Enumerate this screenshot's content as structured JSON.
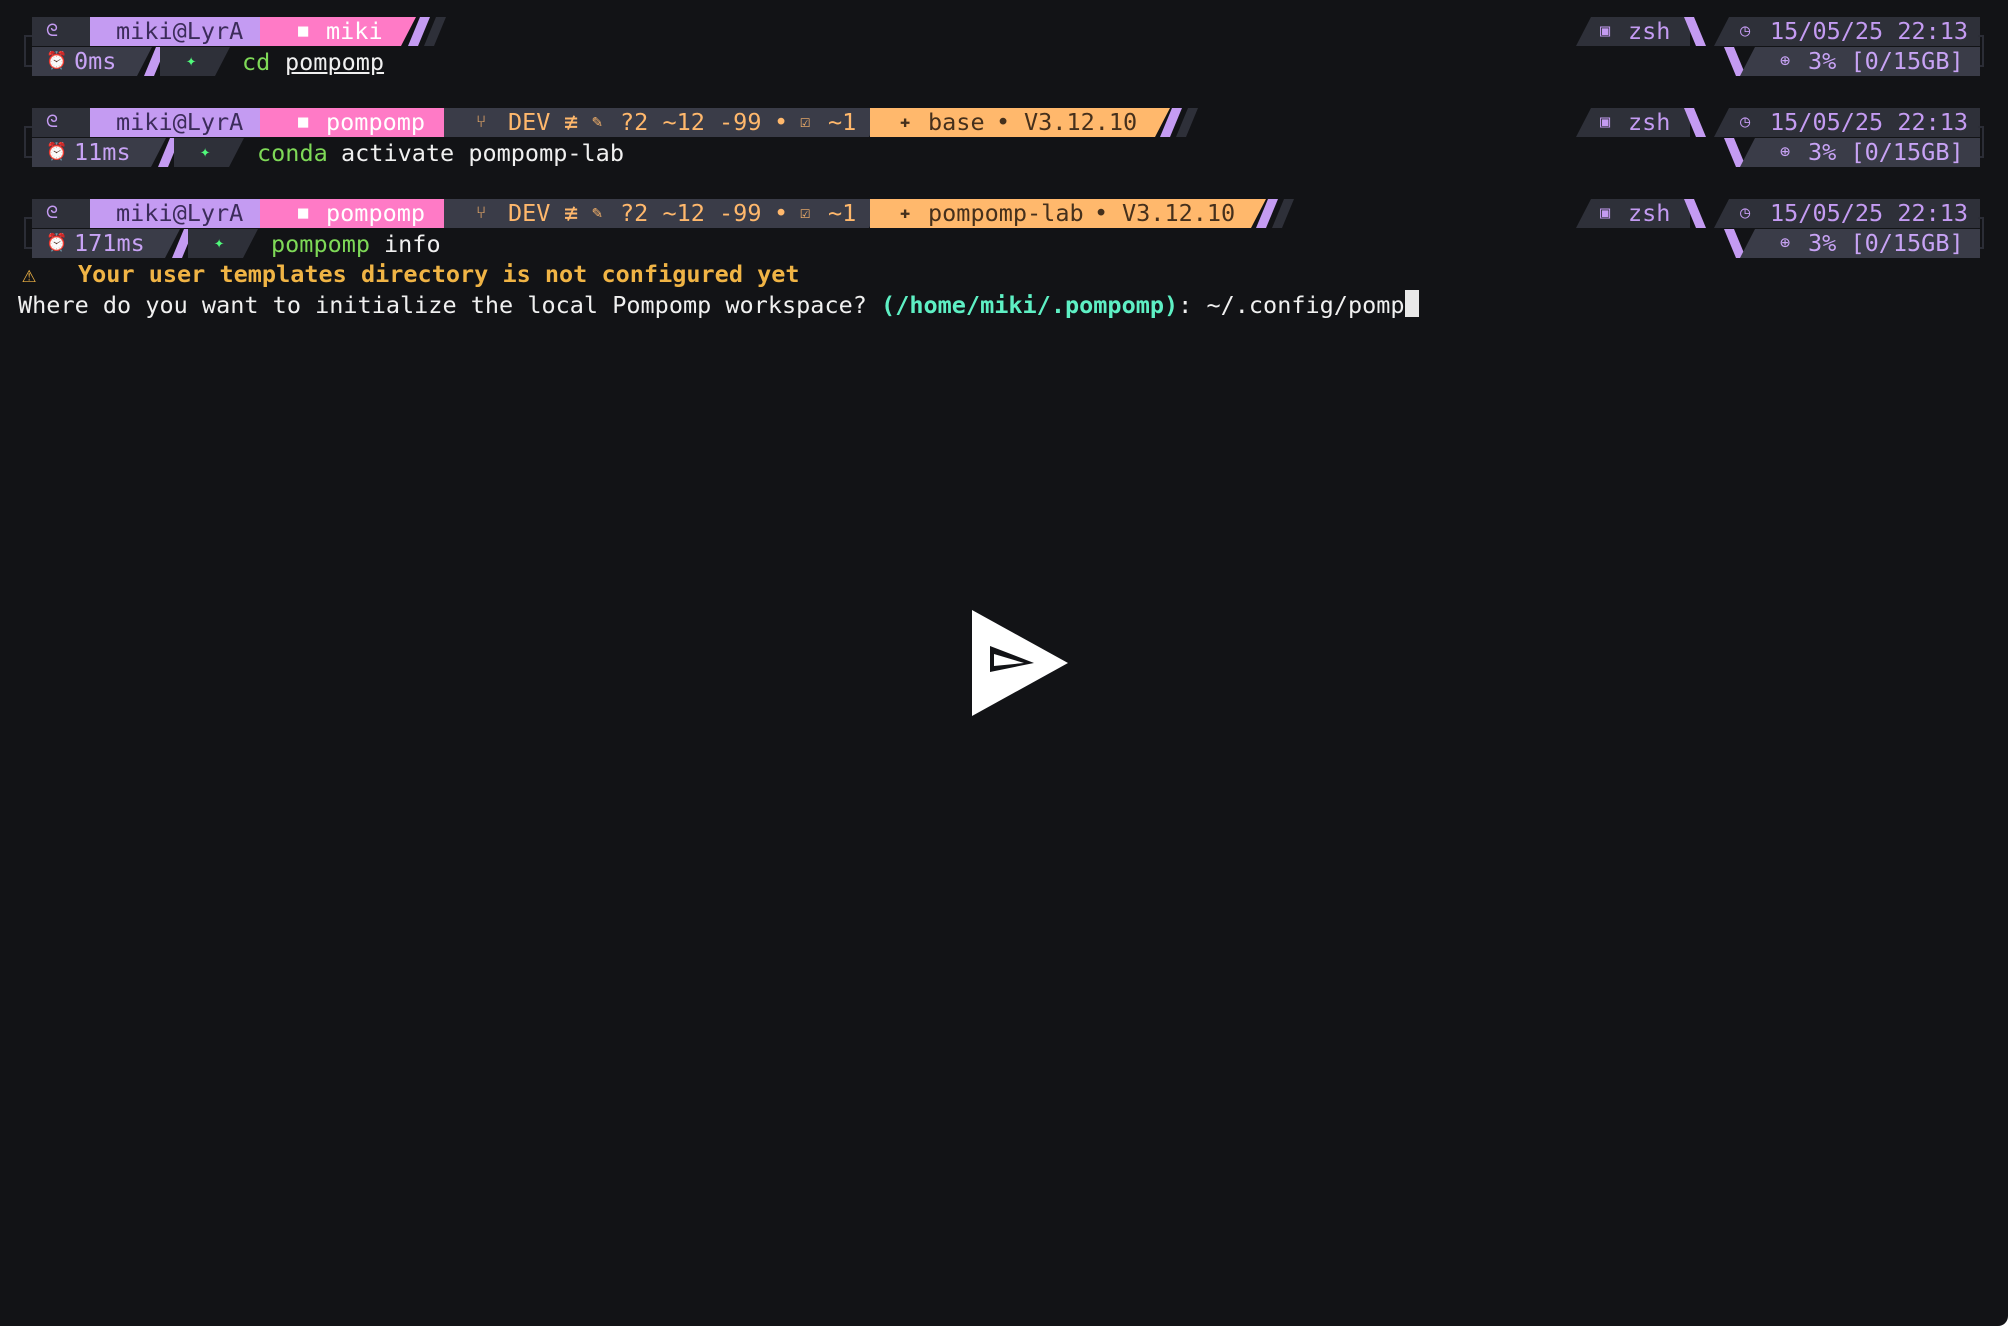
{
  "blocks": [
    {
      "user": "miki@LyrA",
      "dir": "miki",
      "git": null,
      "env": null,
      "shell": "zsh",
      "datetime": "15/05/25 22:13",
      "duration": "0ms",
      "mem": "3% [0/15GB]",
      "cmd": {
        "name": "cd",
        "args": "pompomp"
      }
    },
    {
      "user": "miki@LyrA",
      "dir": "pompomp",
      "git": {
        "branch": "DEV",
        "sync": "≢",
        "status": "?2 ~12 -99",
        "staged": "~1"
      },
      "env": {
        "name": "base",
        "version": "V3.12.10"
      },
      "shell": "zsh",
      "datetime": "15/05/25 22:13",
      "duration": "11ms",
      "mem": "3% [0/15GB]",
      "cmd": {
        "name": "conda",
        "args": "activate pompomp-lab"
      }
    },
    {
      "user": "miki@LyrA",
      "dir": "pompomp",
      "git": {
        "branch": "DEV",
        "sync": "≢",
        "status": "?2 ~12 -99",
        "staged": "~1"
      },
      "env": {
        "name": "pompomp-lab",
        "version": "V3.12.10"
      },
      "shell": "zsh",
      "datetime": "15/05/25 22:13",
      "duration": "171ms",
      "mem": "3% [0/15GB]",
      "cmd": {
        "name": "pompomp",
        "args": "info"
      }
    }
  ],
  "output": {
    "warning": "Your user templates directory is not configured yet",
    "question": "Where do you want to initialize the local Pompomp workspace? ",
    "default_path": "(/home/miki/.pompomp)",
    "separator": ": ",
    "input_value": "~/.config/pomp"
  },
  "icons": {
    "os": "debian-swirl-icon",
    "folder": "folder-icon",
    "branch": "git-branch-icon",
    "edit": "edit-icon",
    "check": "check-icon",
    "env": "python-icon",
    "shell": "terminal-icon",
    "clock": "clock-icon",
    "timer": "timer-icon",
    "prompt": "prompt-arrow-icon",
    "mem": "memory-icon",
    "warning": "warning-icon",
    "play": "play-icon"
  },
  "colors": {
    "background": "#121316",
    "purple": "#c49bf2",
    "pink": "#ff7ac6",
    "orange": "#ffb86c",
    "segment_dark": "#3a3c48",
    "command": "#7ed957",
    "warning": "#f0b445",
    "path": "#5ef0c4"
  }
}
